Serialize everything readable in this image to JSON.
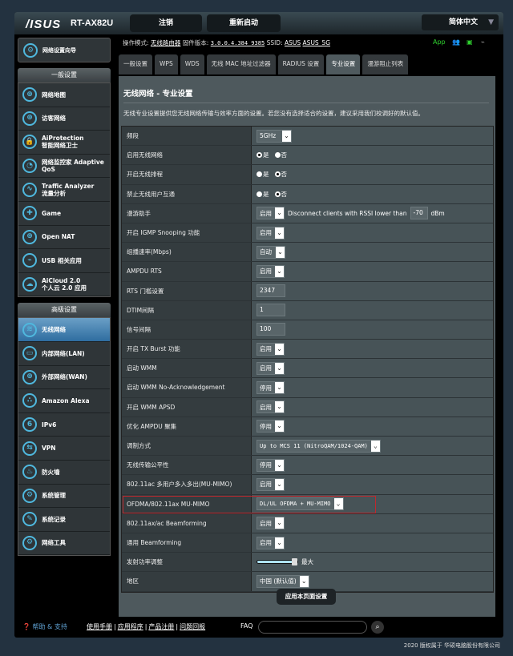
{
  "header": {
    "logo": "/ISUS",
    "model": "RT-AX82U",
    "logout": "注销",
    "reboot": "重新启动",
    "language": "简体中文"
  },
  "status": {
    "mode_label": "操作模式:",
    "mode": "无线路由器",
    "fw_label": "固件版本:",
    "fw": "3.0.0.4.384_9385",
    "ssid_label": "SSID:",
    "ssid1": "ASUS",
    "ssid2": "ASUS_5G",
    "app": "App",
    "accent": "#2fd12f"
  },
  "sidebar": {
    "qis": "网络设置向导",
    "general_title": "一般设置",
    "general": [
      {
        "label": "网络地图",
        "icon": "globe-map-icon",
        "g": "⊕"
      },
      {
        "label": "访客网络",
        "icon": "guest-network-icon",
        "g": "⊕"
      },
      {
        "label": "AiProtection\n智能网络卫士",
        "icon": "shield-lock-icon",
        "g": "🔒"
      },
      {
        "label": "网络监控家 Adaptive QoS",
        "icon": "speedometer-icon",
        "g": "◔"
      },
      {
        "label": "Traffic Analyzer\n流量分析",
        "icon": "traffic-wave-icon",
        "g": "∿"
      },
      {
        "label": "Game",
        "icon": "gamepad-icon",
        "g": "✚"
      },
      {
        "label": "Open NAT",
        "icon": "open-nat-icon",
        "g": "⊕"
      },
      {
        "label": "USB 相关应用",
        "icon": "usb-icon",
        "g": "⌁"
      },
      {
        "label": "AiCloud 2.0\n个人云 2.0 应用",
        "icon": "cloud-icon",
        "g": "☁"
      }
    ],
    "advanced_title": "高级设置",
    "advanced": [
      {
        "label": "无线网络",
        "icon": "wireless-icon",
        "g": "≋",
        "active": true
      },
      {
        "label": "内部网络(LAN)",
        "icon": "lan-icon",
        "g": "▭"
      },
      {
        "label": "外部网络(WAN)",
        "icon": "wan-globe-icon",
        "g": "⊕"
      },
      {
        "label": "Amazon Alexa",
        "icon": "alexa-icon",
        "g": "∴"
      },
      {
        "label": "IPv6",
        "icon": "ipv6-icon",
        "g": "6"
      },
      {
        "label": "VPN",
        "icon": "vpn-icon",
        "g": "⇆"
      },
      {
        "label": "防火墙",
        "icon": "firewall-icon",
        "g": "♨"
      },
      {
        "label": "系统管理",
        "icon": "system-admin-icon",
        "g": "⚙"
      },
      {
        "label": "系统记录",
        "icon": "system-log-icon",
        "g": "✎"
      },
      {
        "label": "网络工具",
        "icon": "network-tools-icon",
        "g": "⚙"
      }
    ]
  },
  "tabs": [
    "一般设置",
    "WPS",
    "WDS",
    "无线 MAC 地址过滤器",
    "RADIUS 设置",
    "专业设置",
    "漫游阻止列表"
  ],
  "active_tab": 5,
  "page": {
    "title": "无线网络 - 专业设置",
    "description": "无线专业设置提供您无线网络传输与效率方面的设置。若您没有选择适合的设置，建议采用我们校调好的默认值。",
    "apply": "应用本页面设置"
  },
  "rows": [
    {
      "label": "频段",
      "type": "select",
      "value": "5GHz",
      "w": 44
    },
    {
      "label": "启用无线网络",
      "type": "radio",
      "yes": "是",
      "no": "否",
      "selected": "yes"
    },
    {
      "label": "开启无线排程",
      "type": "radio",
      "yes": "是",
      "no": "否",
      "selected": "no"
    },
    {
      "label": "禁止无线用户互通",
      "type": "radio",
      "yes": "是",
      "no": "否",
      "selected": "no"
    },
    {
      "label": "漫游助手",
      "type": "roam",
      "value": "启用",
      "text": "Disconnect clients with RSSI lower than",
      "rssi": "-70",
      "unit": "dBm"
    },
    {
      "label": "开启 IGMP Snooping 功能",
      "type": "select",
      "value": "启用"
    },
    {
      "label": "组播速率(Mbps)",
      "type": "select",
      "value": "自动",
      "w": 36
    },
    {
      "label": "AMPDU RTS",
      "type": "select",
      "value": "启用"
    },
    {
      "label": "RTS 门槛设置",
      "type": "text",
      "value": "2347"
    },
    {
      "label": "DTIM间隔",
      "type": "text",
      "value": "1"
    },
    {
      "label": "信号间隔",
      "type": "text",
      "value": "100"
    },
    {
      "label": "开启 TX Burst 功能",
      "type": "select",
      "value": "启用"
    },
    {
      "label": "启动 WMM",
      "type": "select",
      "value": "启用"
    },
    {
      "label": "启动 WMM No-Acknowledgement",
      "type": "select",
      "value": "停用"
    },
    {
      "label": "开启 WMM APSD",
      "type": "select",
      "value": "启用"
    },
    {
      "label": "优化 AMPDU 聚集",
      "type": "select",
      "value": "停用"
    },
    {
      "label": "调制方式",
      "type": "select",
      "value": "Up to MCS 11 (NitroQAM/1024-QAM)",
      "mono": true
    },
    {
      "label": "无线传输公平性",
      "type": "select",
      "value": "停用"
    },
    {
      "label": "802.11ac 多用户多入多出(MU-MIMO)",
      "type": "select",
      "value": "启用"
    },
    {
      "label": "OFDMA/802.11ax MU-MIMO",
      "type": "select",
      "value": "DL/UL OFDMA + MU-MIMO",
      "mono": true,
      "highlight": true
    },
    {
      "label": "802.11ax/ac Beamforming",
      "type": "select",
      "value": "启用"
    },
    {
      "label": "通用 Beamforming",
      "type": "select",
      "value": "启用"
    },
    {
      "label": "发射功率调整",
      "type": "slider",
      "percent": 100,
      "text": "最大"
    },
    {
      "label": "地区",
      "type": "select",
      "value": "中国 (默认值)"
    }
  ],
  "footer": {
    "help": "帮助 & 支持",
    "links": [
      "使用手册",
      "应用程序",
      "产品注册",
      "问题回报"
    ],
    "faq": "FAQ",
    "copyright": "2020 版权属于 华硕电脑股份有限公司"
  }
}
